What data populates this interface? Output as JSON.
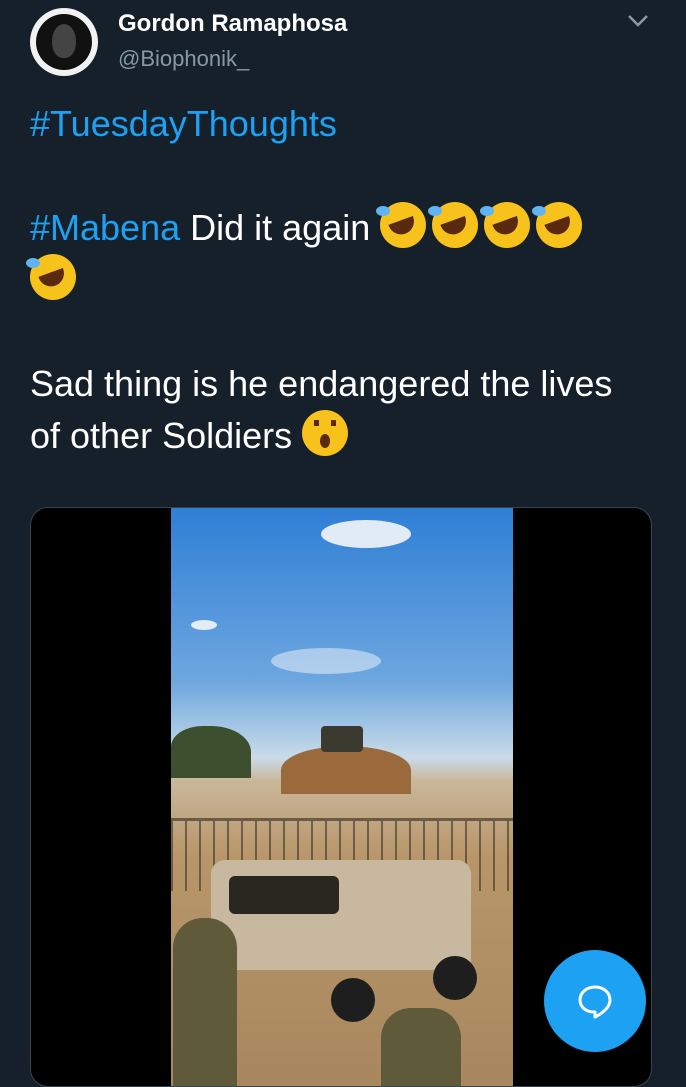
{
  "user": {
    "display_name": "Gordon Ramaphosa",
    "handle": "@Biophonik_",
    "avatar_icon": "avatar-icon"
  },
  "tweet": {
    "line1_hashtag": "#TuesdayThoughts",
    "line2_hashtag": "#Mabena",
    "line2_text": " Did it again ",
    "line2_emoji": "rolling-on-floor-laughing x5",
    "line3_text": "Sad thing is he endangered the lives of other Soldiers ",
    "line3_emoji": "hushed-face"
  },
  "media": {
    "type": "video",
    "content": "military-vehicle-and-soldiers"
  },
  "actions": {
    "more_icon": "chevron-down-icon",
    "reply_icon": "reply-icon"
  },
  "colors": {
    "background": "#15202b",
    "accent": "#1da1f2",
    "text": "#ffffff",
    "muted": "#8899a6"
  }
}
